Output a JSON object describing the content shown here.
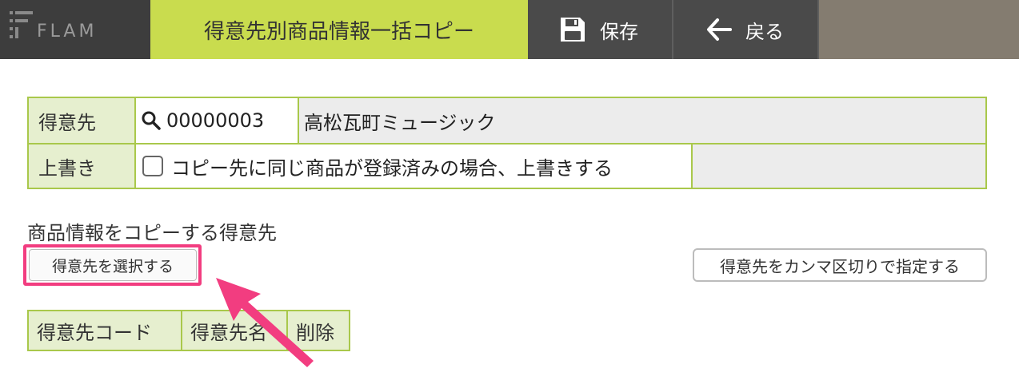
{
  "header": {
    "logo_text": "FLAM",
    "title": "得意先別商品情報一括コピー",
    "save_label": "保存",
    "back_label": "戻る"
  },
  "form": {
    "customer_label": "得意先",
    "customer_code": "00000003",
    "customer_name": "高松瓦町ミュージック",
    "overwrite_label": "上書き",
    "overwrite_option": "コピー先に同じ商品が登録済みの場合、上書きする",
    "overwrite_checked": false
  },
  "section": {
    "title": "商品情報をコピーする得意先",
    "select_button": "得意先を選択する",
    "comma_button": "得意先をカンマ区切りで指定する"
  },
  "result_table": {
    "columns": [
      "得意先コード",
      "得意先名",
      "削除"
    ]
  },
  "colors": {
    "accent": "#c9dc4e",
    "header_dark": "#4a4a4a",
    "border_green": "#a9c84b",
    "highlight_pink": "#f23d80"
  }
}
